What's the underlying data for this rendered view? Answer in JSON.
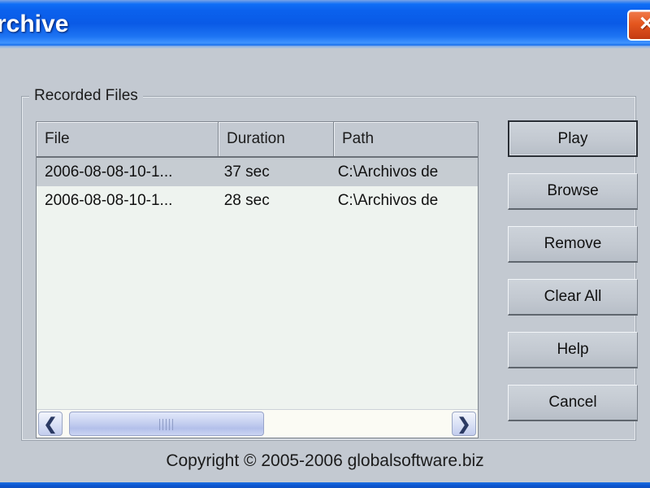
{
  "window": {
    "title": "rchive",
    "close_label": "✕",
    "close_icon": "close-icon"
  },
  "colors": {
    "titlebar_blue": "#0a5ad8",
    "close_red": "#e4561f",
    "dialog_face": "#c3c9d1",
    "list_background": "#eef3ef",
    "selection": "#c6ccd2",
    "scroll_thumb": "#c6d0f0"
  },
  "group": {
    "label": "Recorded Files"
  },
  "list": {
    "columns": [
      {
        "key": "file",
        "label": "File"
      },
      {
        "key": "duration",
        "label": "Duration"
      },
      {
        "key": "path",
        "label": "Path"
      }
    ],
    "rows": [
      {
        "file": "2006-08-08-10-1...",
        "duration": "37 sec",
        "path": "C:\\Archivos de",
        "selected": true
      },
      {
        "file": "2006-08-08-10-1...",
        "duration": "28 sec",
        "path": "C:\\Archivos de",
        "selected": false
      }
    ],
    "scrollbar": {
      "left_arrow": "❮",
      "right_arrow": "❯"
    }
  },
  "buttons": [
    {
      "label": "Play",
      "default": true
    },
    {
      "label": "Browse",
      "default": false
    },
    {
      "label": "Remove",
      "default": false
    },
    {
      "label": "Clear All",
      "default": false
    },
    {
      "label": "Help",
      "default": false
    },
    {
      "label": "Cancel",
      "default": false
    }
  ],
  "footer": {
    "copyright": "Copyright © 2005-2006 globalsoftware.biz"
  }
}
